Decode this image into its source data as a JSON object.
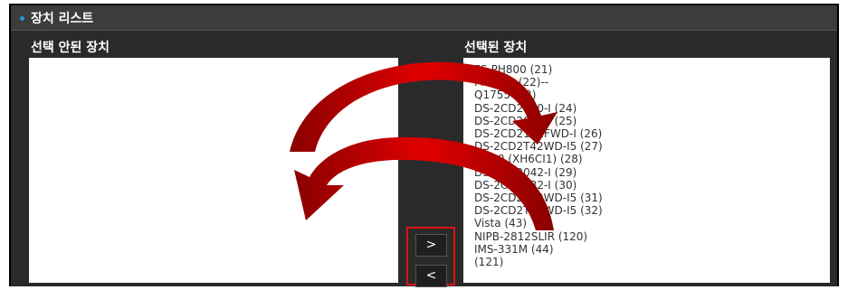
{
  "header": {
    "title": "장치 리스트"
  },
  "left_panel": {
    "label": "선택 안된 장치"
  },
  "right_panel": {
    "label": "선택된 장치",
    "items": [
      "FS-PH800 (21)",
      "MBI308 (22)--",
      "Q1755 (23)",
      "DS-2CD2010-I (24)",
      "DS-2CD2032-I (25)",
      "DS-2CD2142FWD-I (26)",
      "DS-2CD2T42WD-I5 (27)",
      "HD10 (XH6CI1) (28)",
      "DS-2CD2042-I (29)",
      "DS-2CD2032-I (30)",
      "DS-2CD2T42WD-I5 (31)",
      "DS-2CD2T42WD-I5 (32)",
      "Vista (43)",
      "NIPB-2812SLIR (120)",
      "IMS-331M (44)",
      "(121)"
    ]
  },
  "buttons": {
    "add": ">",
    "remove": "<"
  },
  "colors": {
    "accent": "#1e9bd8",
    "highlight": "#e01010",
    "arrow": "#d40000"
  },
  "icons": {
    "bullet": "dot-icon",
    "curved_arrow_right": "curved-arrow-right-icon",
    "curved_arrow_left": "curved-arrow-left-icon"
  }
}
